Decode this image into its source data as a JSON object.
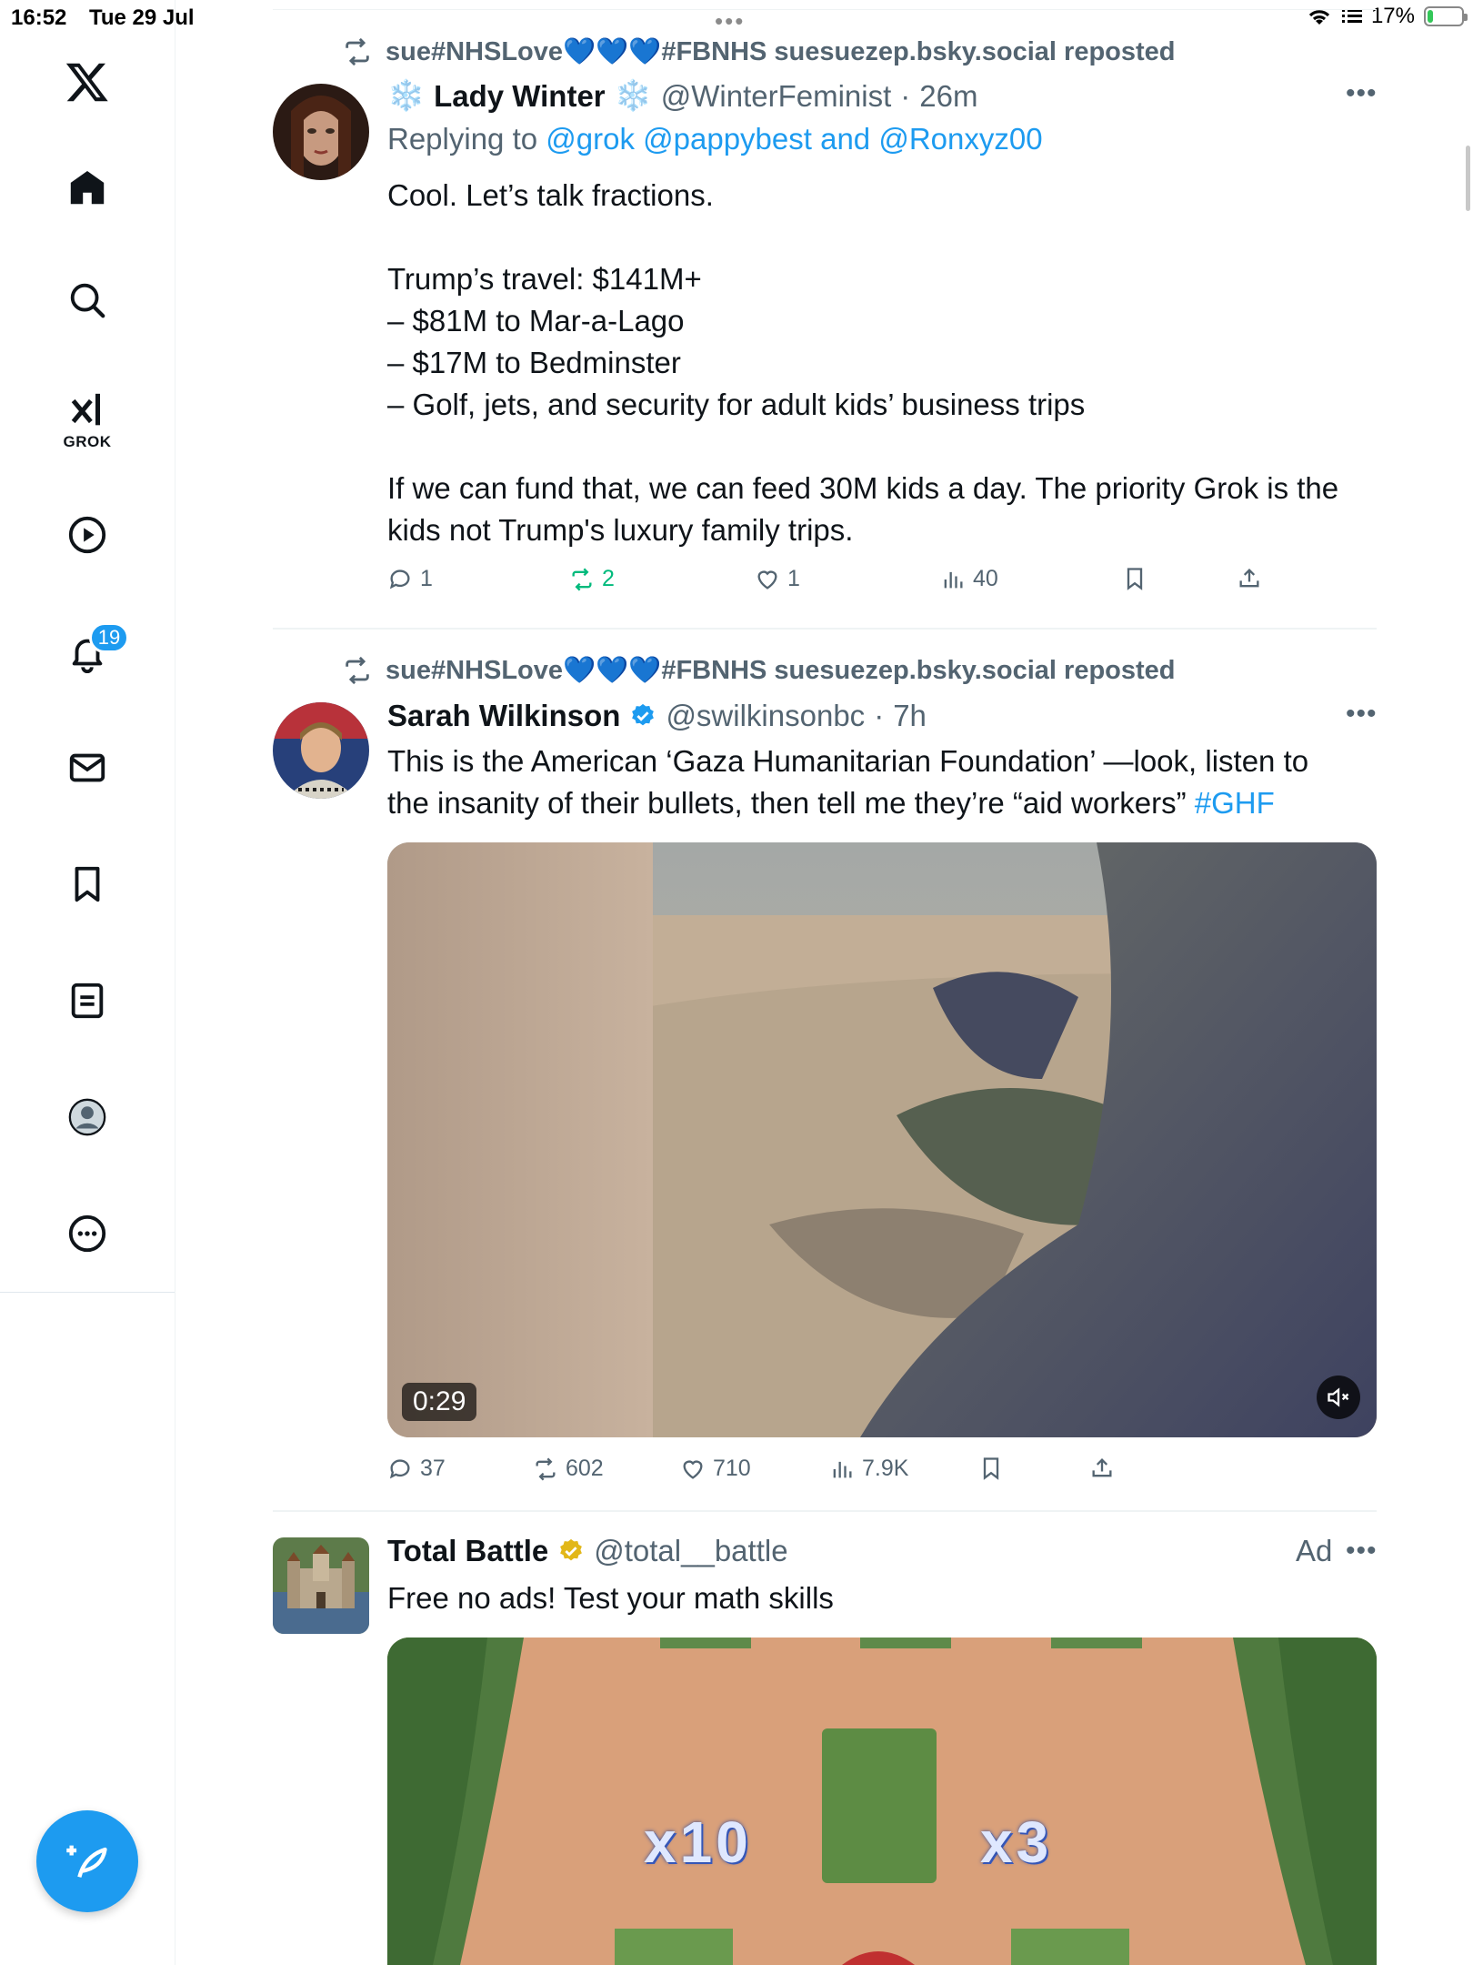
{
  "status_bar": {
    "time": "16:52",
    "date": "Tue 29 Jul",
    "battery": "17%",
    "battery_level": 0.17
  },
  "sidebar": {
    "grok_label": "GROK",
    "notifications_count": "19"
  },
  "tweets": [
    {
      "repost_by": "sue#NHSLove💙💙💙#FBNHS suesuezep.bsky.social reposted",
      "name": "Lady Winter",
      "name_emoji": "❄️",
      "handle": "@WinterFeminist",
      "time": "26m",
      "replying_prefix": "Replying to",
      "replying_to": "@grok @pappybest and @Ronxyz00",
      "lines": [
        "Cool. Let’s talk fractions.",
        "",
        "Trump’s travel: $141M+",
        "– $81M to Mar-a-Lago",
        "– $17M to Bedminster",
        "– Golf, jets, and security for adult kids’ business trips",
        "",
        "If we can fund that, we can feed 30M kids a day. The priority Grok is the",
        "kids not Trump's luxury family trips."
      ],
      "replies": "1",
      "reposts": "2",
      "likes": "1",
      "views": "40"
    },
    {
      "repost_by": "sue#NHSLove💙💙💙#FBNHS suesuezep.bsky.social reposted",
      "name": "Sarah Wilkinson",
      "handle": "@swilkinsonbc",
      "time": "7h",
      "line1": "This is the American ‘Gaza Humanitarian Foundation’ —look, listen to",
      "line2": "the insanity of their bullets, then tell me they’re “aid workers”",
      "hashtag": "#GHF",
      "video_duration": "0:29",
      "replies": "37",
      "reposts": "602",
      "likes": "710",
      "views": "7.9K"
    },
    {
      "name": "Total Battle",
      "handle": "@total__battle",
      "ad_label": "Ad",
      "text": "Free no ads! Test your math skills",
      "gate_left": "x10",
      "gate_right": "x3"
    }
  ],
  "colors": {
    "accent": "#1d9bf0",
    "repost_green": "#00ba7c",
    "secondary_text": "#536471"
  },
  "icons": [
    "x-logo-icon",
    "home-icon",
    "search-icon",
    "grok-icon",
    "video-icon",
    "bell-icon",
    "mail-icon",
    "bookmark-icon",
    "lists-icon",
    "profile-icon",
    "more-circle-icon",
    "compose-icon",
    "repost-icon",
    "reply-icon",
    "like-icon",
    "views-icon",
    "share-icon",
    "mute-icon",
    "verified-icon"
  ]
}
